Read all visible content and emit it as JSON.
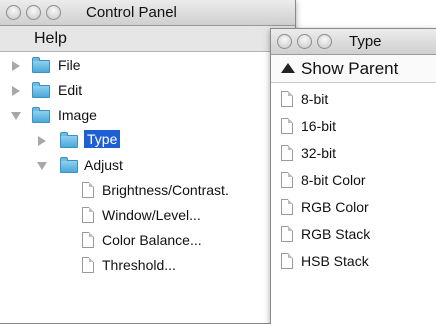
{
  "control_panel": {
    "title": "Control Panel",
    "menu": [
      "Help"
    ],
    "tree": [
      {
        "label": "File"
      },
      {
        "label": "Edit"
      },
      {
        "label": "Image"
      },
      {
        "label": "Type"
      },
      {
        "label": "Adjust"
      },
      {
        "label": "Brightness/Contrast."
      },
      {
        "label": "Window/Level..."
      },
      {
        "label": "Color Balance..."
      },
      {
        "label": "Threshold..."
      }
    ]
  },
  "type_window": {
    "title": "Type",
    "show_parent": "Show Parent",
    "items": [
      "8-bit",
      "16-bit",
      "32-bit",
      "8-bit Color",
      "RGB Color",
      "RGB Stack",
      "HSB Stack"
    ]
  },
  "colors": {
    "selection": "#1f5fd6",
    "folder": "#4aa8db"
  }
}
